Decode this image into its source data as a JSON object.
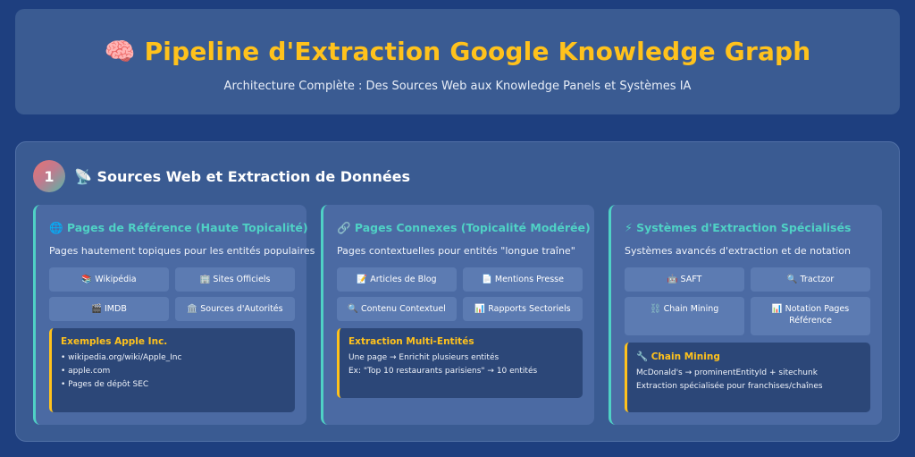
{
  "header": {
    "title": "🧠 Pipeline d'Extraction Google Knowledge Graph",
    "subtitle": "Architecture Complète : Des Sources Web aux Knowledge Panels et Systèmes IA"
  },
  "section": {
    "number": "1",
    "title": "📡 Sources Web et Extraction de Données"
  },
  "cards": [
    {
      "title": "🌐 Pages de Référence (Haute Topicalité)",
      "description": "Pages hautement topiques pour les entités populaires",
      "buttons": [
        "📚 Wikipédia",
        "🏢 Sites Officiels",
        "🎬 IMDB",
        "🏛️ Sources d'Autorités"
      ],
      "box": {
        "title": "Exemples Apple Inc.",
        "lines": [
          "• wikipedia.org/wiki/Apple_Inc",
          "• apple.com",
          "• Pages de dépôt SEC"
        ]
      }
    },
    {
      "title": "🔗 Pages Connexes (Topicalité Modérée)",
      "description": "Pages contextuelles pour entités \"longue traîne\"",
      "buttons": [
        "📝 Articles de Blog",
        "📄 Mentions Presse",
        "🔍 Contenu Contextuel",
        "📊 Rapports Sectoriels"
      ],
      "box": {
        "title": "Extraction Multi-Entités",
        "lines": [
          "Une page → Enrichit plusieurs entités",
          "Ex: \"Top 10 restaurants parisiens\" → 10 entités"
        ]
      }
    },
    {
      "title": "⚡ Systèmes d'Extraction Spécialisés",
      "description": "Systèmes avancés d'extraction et de notation",
      "buttons": [
        "🤖 SAFT",
        "🔍 Tractzor",
        "⛓️ Chain Mining",
        "📊 Notation Pages Référence"
      ],
      "box": {
        "title": "🔧 Chain Mining",
        "lines": [
          "McDonald's → prominentEntityId + sitechunk",
          "Extraction spécialisée pour franchises/chaînes"
        ]
      }
    }
  ]
}
